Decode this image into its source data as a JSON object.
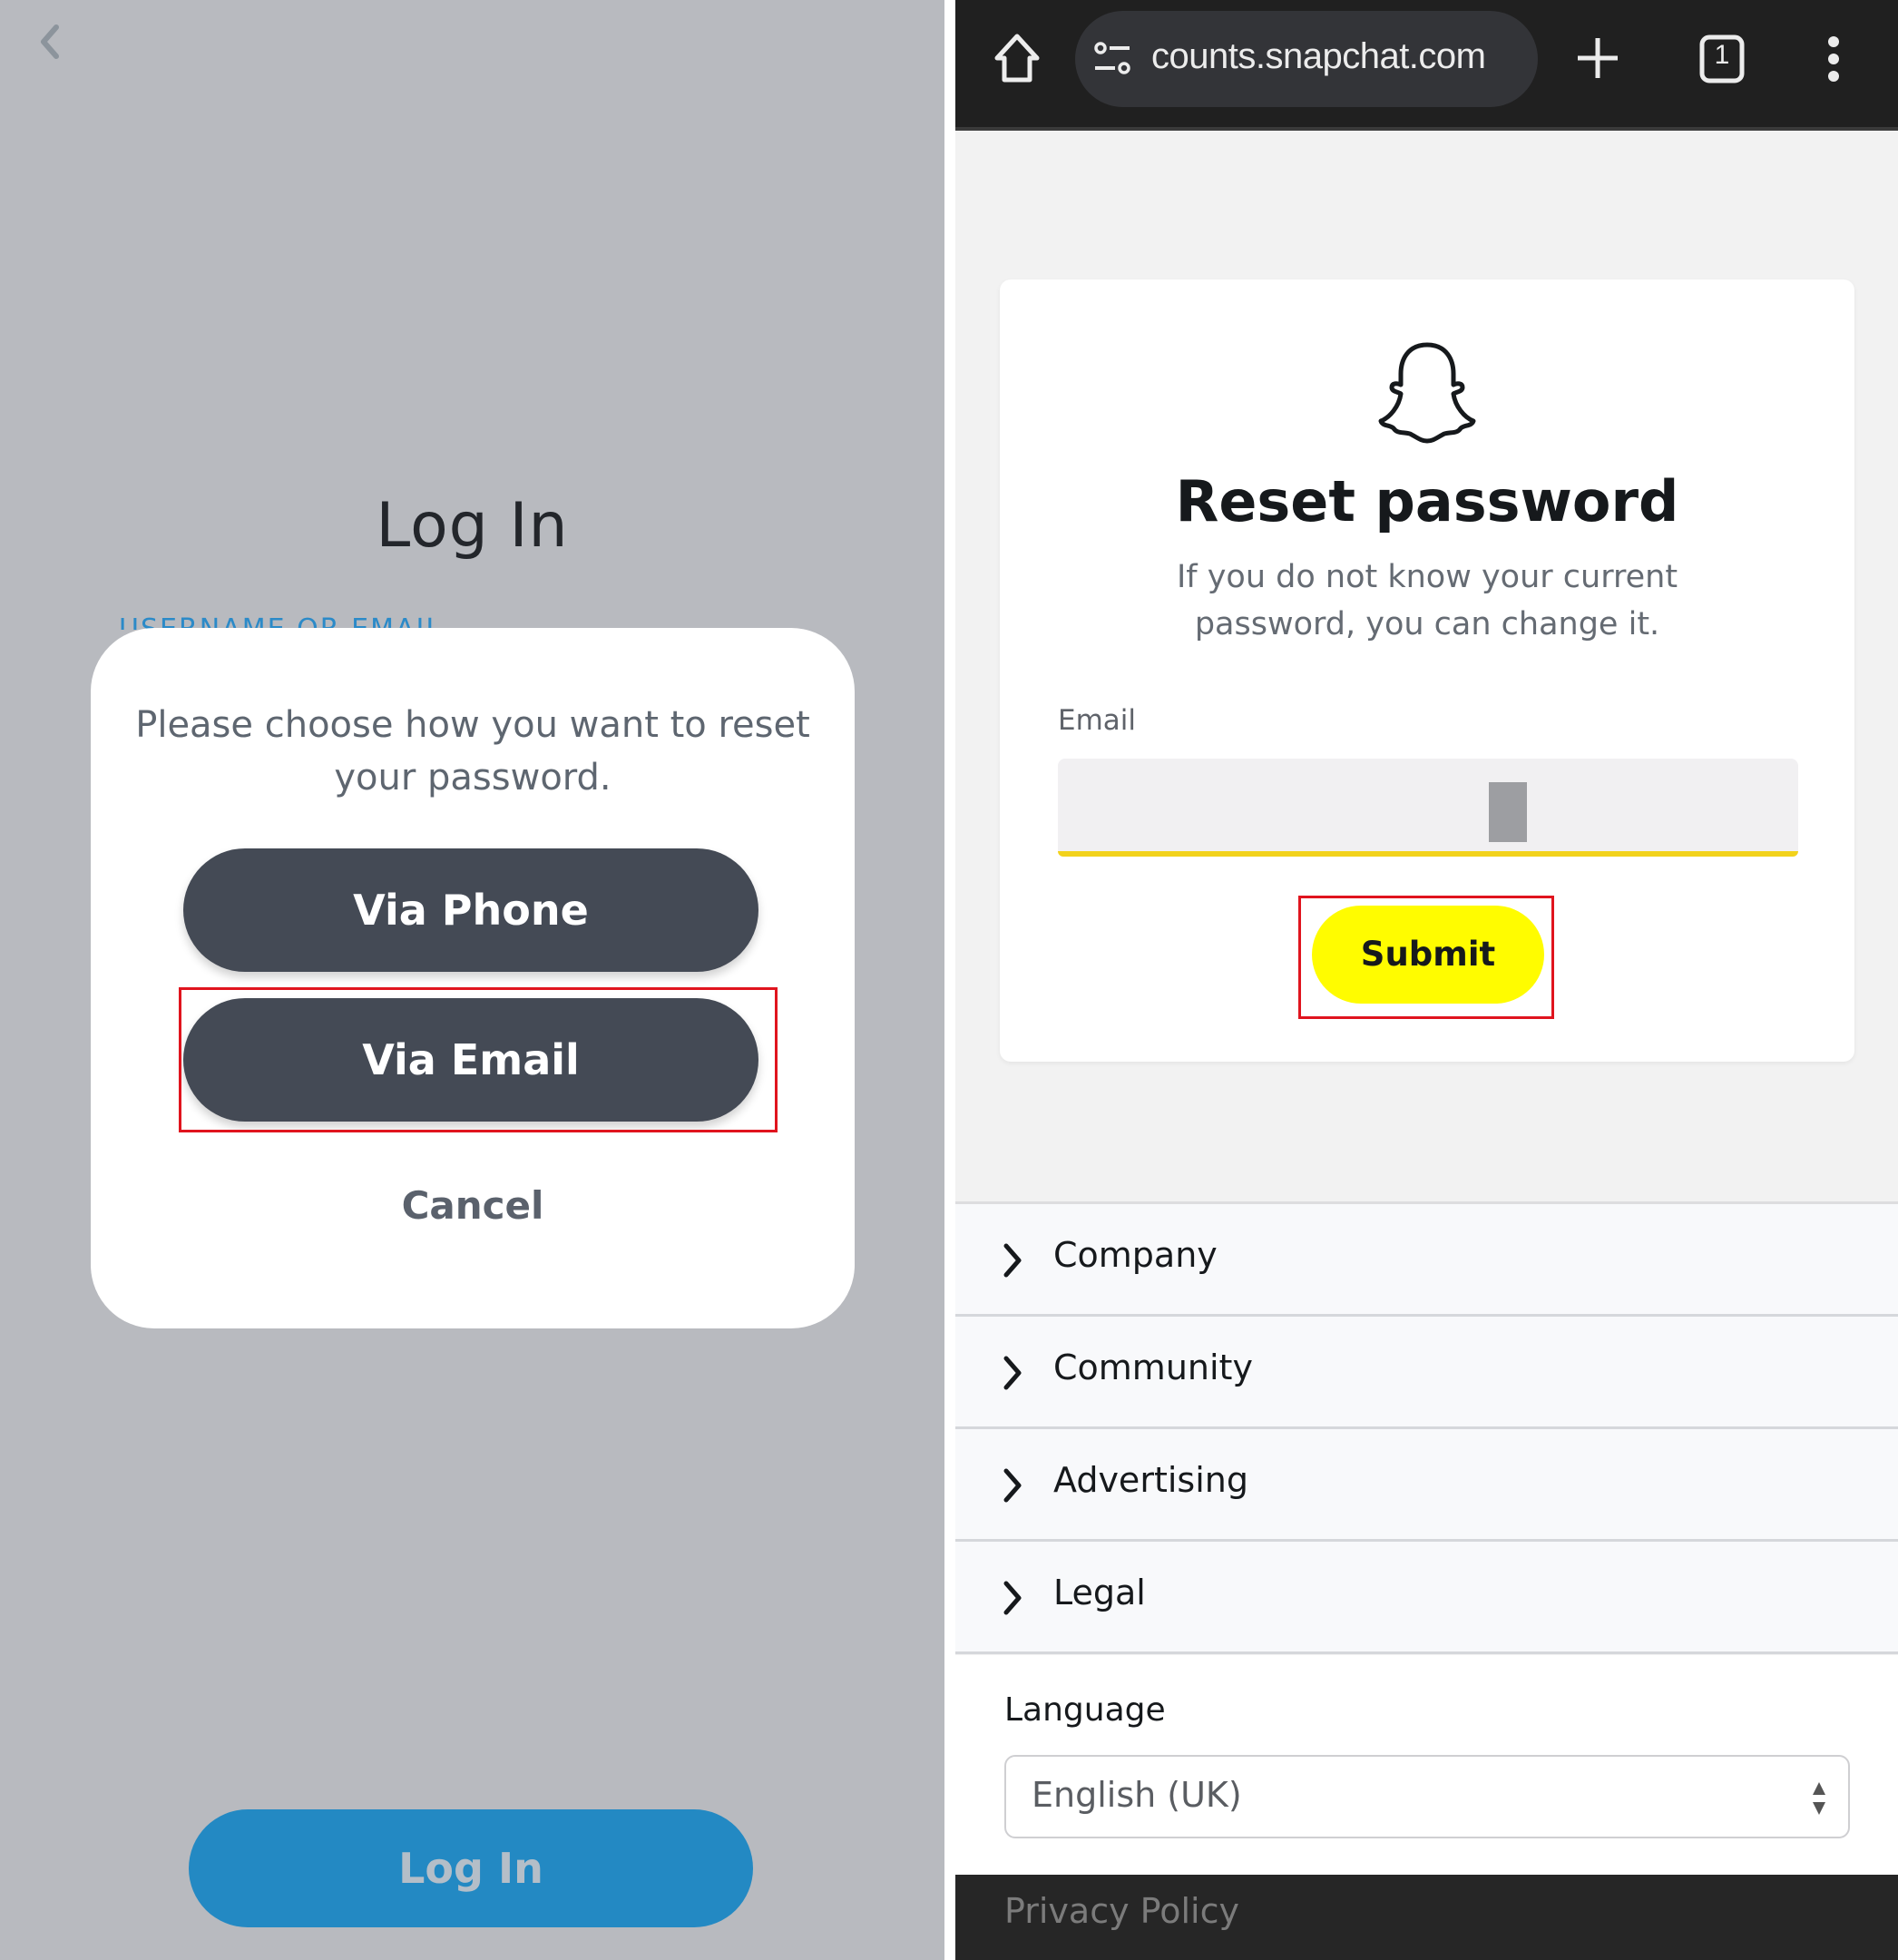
{
  "left_screen": {
    "title": "Log In",
    "username_label": "USERNAME OR EMAIL",
    "dialog": {
      "message": "Please choose how you want to reset your password.",
      "options": [
        {
          "label": "Via Phone",
          "highlighted": false
        },
        {
          "label": "Via Email",
          "highlighted": true
        }
      ],
      "cancel_label": "Cancel"
    },
    "login_button": "Log In",
    "colors": {
      "background": "#b8babf",
      "button_dark": "#444a55",
      "login_blue": "#2389c3",
      "highlight": "#e0141e"
    }
  },
  "right_screen": {
    "browser": {
      "url": "counts.snapchat.com",
      "tab_count": "1",
      "icons": [
        "home-icon",
        "site-settings-icon",
        "new-tab-icon",
        "tabs-icon",
        "menu-icon"
      ]
    },
    "card": {
      "logo": "snapchat-ghost-icon",
      "title": "Reset password",
      "description": "If you do not know your current password, you can change it.",
      "email_label": "Email",
      "email_value": "",
      "submit_label": "Submit",
      "submit_highlighted": true
    },
    "footer_nav": [
      {
        "label": "Company"
      },
      {
        "label": "Community"
      },
      {
        "label": "Advertising"
      },
      {
        "label": "Legal"
      }
    ],
    "language": {
      "label": "Language",
      "selected": "English (UK)"
    },
    "privacy_link": "Privacy Policy",
    "colors": {
      "snap_yellow": "#fffc00",
      "input_underline": "#f2d21c",
      "browser_bar": "#202020"
    }
  }
}
